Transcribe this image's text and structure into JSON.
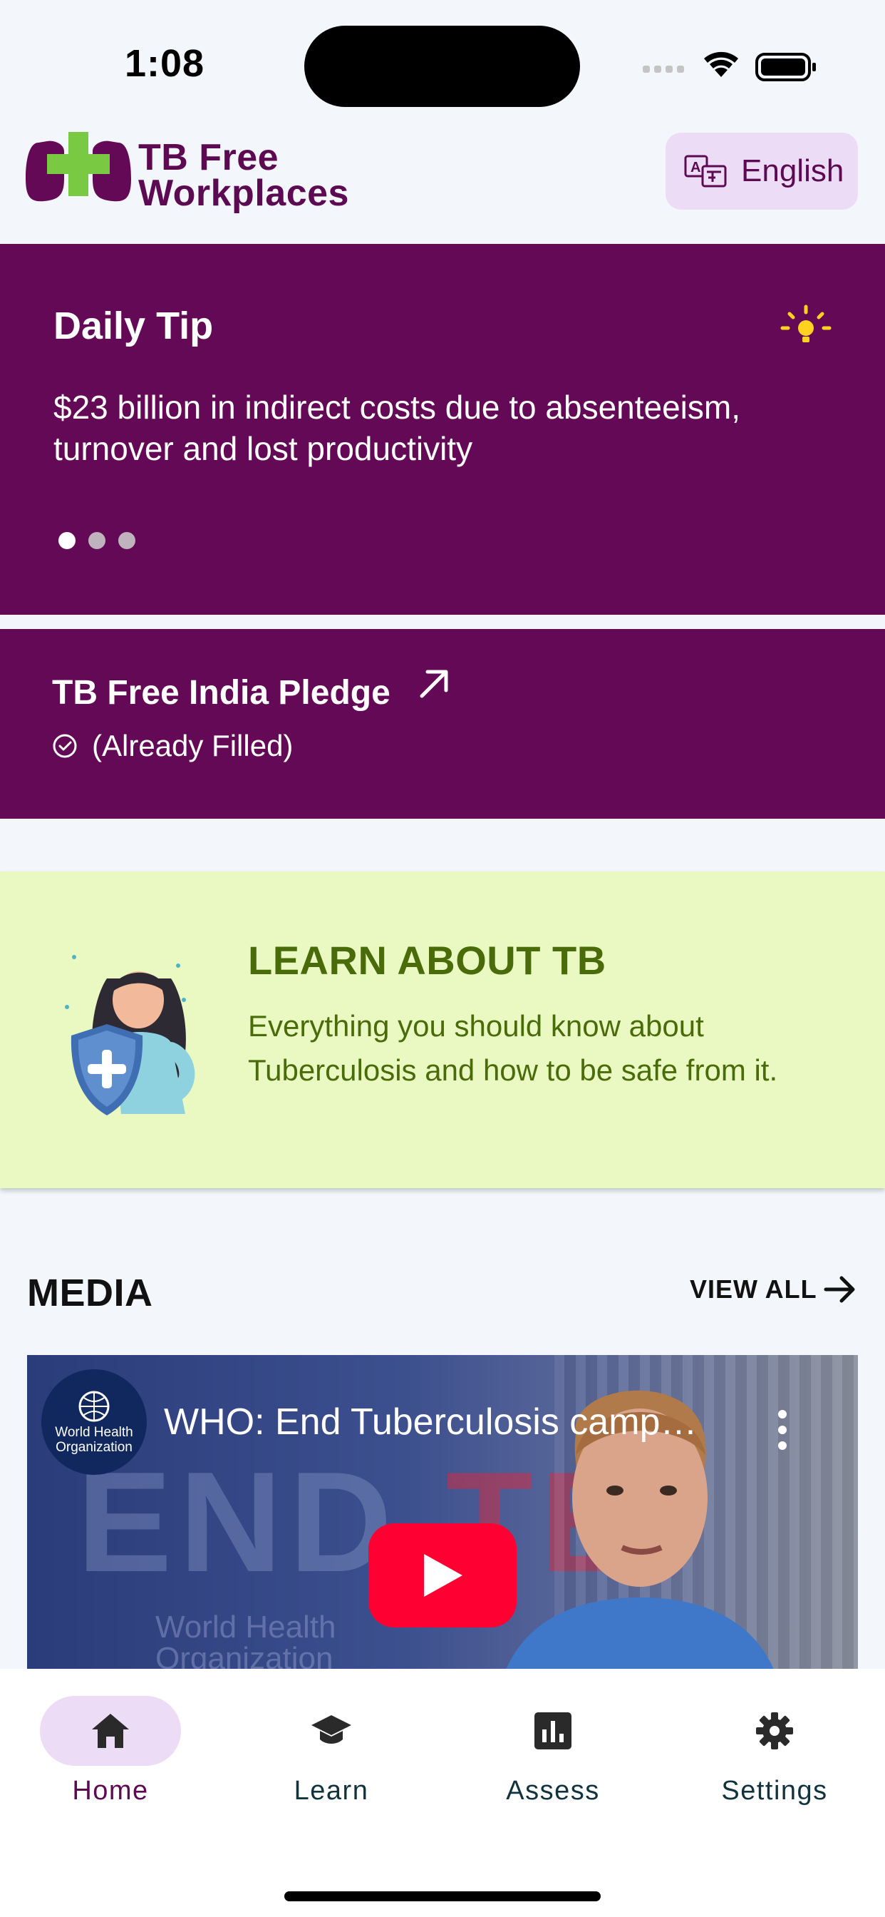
{
  "status_bar": {
    "time": "1:08"
  },
  "header": {
    "logo_line1": "TB Free",
    "logo_line2": "Workplaces",
    "language_label": "English"
  },
  "daily_tip": {
    "title": "Daily Tip",
    "text": "$23 billion in indirect costs due to absenteeism, turnover and lost productivity",
    "dots_total": 3,
    "active_dot": 1
  },
  "pledge": {
    "title": "TB Free India Pledge",
    "status": "(Already Filled)"
  },
  "learn": {
    "title": "LEARN ABOUT TB",
    "description": "Everything you should know about Tuberculosis and how to be safe from it."
  },
  "media": {
    "title": "MEDIA",
    "view_all_label": "VIEW ALL",
    "video": {
      "title": "WHO: End Tuberculosis camp…",
      "channel_line1": "World Health",
      "channel_line2": "Organization",
      "bg_text_end": "END",
      "bg_text_tb": "TB",
      "bg_who_line1": "World Health",
      "bg_who_line2": "Organization"
    }
  },
  "tabs": [
    {
      "label": "Home",
      "icon": "home-icon",
      "active": true
    },
    {
      "label": "Learn",
      "icon": "graduation-cap-icon",
      "active": false
    },
    {
      "label": "Assess",
      "icon": "bar-chart-icon",
      "active": false
    },
    {
      "label": "Settings",
      "icon": "gear-icon",
      "active": false
    }
  ],
  "colors": {
    "brand_purple": "#640955",
    "brand_green": "#7ac943",
    "learn_bg": "#e9f9c1",
    "learn_text": "#4a6b0a",
    "tab_active_bg": "#ecdcf6",
    "play_red": "#ff0033"
  }
}
